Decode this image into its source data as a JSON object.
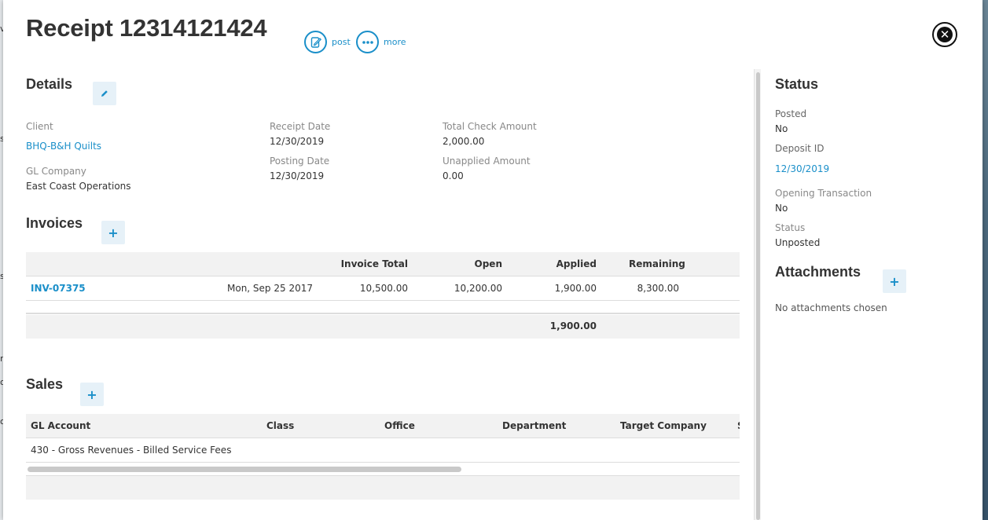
{
  "receipt": {
    "title": "Receipt 12314121424",
    "actions": {
      "post_label": "post",
      "more_label": "more"
    }
  },
  "details": {
    "heading": "Details",
    "client_label": "Client",
    "client_value": "BHQ-B&H Quilts",
    "gl_company_label": "GL Company",
    "gl_company_value": "East Coast Operations",
    "receipt_date_label": "Receipt Date",
    "receipt_date_value": "12/30/2019",
    "posting_date_label": "Posting Date",
    "posting_date_value": "12/30/2019",
    "total_check_label": "Total Check Amount",
    "total_check_value": "2,000.00",
    "unapplied_label": "Unapplied Amount",
    "unapplied_value": "0.00"
  },
  "invoices": {
    "heading": "Invoices",
    "columns": [
      "Invoice Total",
      "Open",
      "Applied",
      "Remaining"
    ],
    "rows": [
      {
        "invoice": "INV-07375",
        "date": "Mon, Sep 25 2017",
        "invoice_total": "10,500.00",
        "open": "10,200.00",
        "applied": "1,900.00",
        "remaining": "8,300.00"
      }
    ],
    "applied_total": "1,900.00"
  },
  "sales": {
    "heading": "Sales",
    "columns": [
      "GL Account",
      "Class",
      "Office",
      "Department",
      "Target Company",
      "S"
    ],
    "rows": [
      {
        "gl_account": "430 - Gross Revenues - Billed Service Fees"
      }
    ]
  },
  "status": {
    "heading": "Status",
    "posted_label": "Posted",
    "posted_value": "No",
    "deposit_label": "Deposit ID",
    "deposit_value": "12/30/2019",
    "opening_label": "Opening Transaction",
    "opening_value": "No",
    "status_label": "Status",
    "status_value": "Unposted"
  },
  "attachments": {
    "heading": "Attachments",
    "empty_text": "No attachments chosen"
  },
  "background": {
    "edge_chars": [
      "v",
      "s",
      "s",
      "r",
      "o",
      "o"
    ]
  },
  "colors": {
    "accent": "#1a8fc9",
    "header_bg": "#f2f2f2",
    "button_bg": "#e6f1f8"
  },
  "icons": {
    "post": "edit-document-icon",
    "more": "more-dots-icon",
    "close": "close-circle-icon",
    "edit": "pencil-icon",
    "add": "plus-icon"
  }
}
